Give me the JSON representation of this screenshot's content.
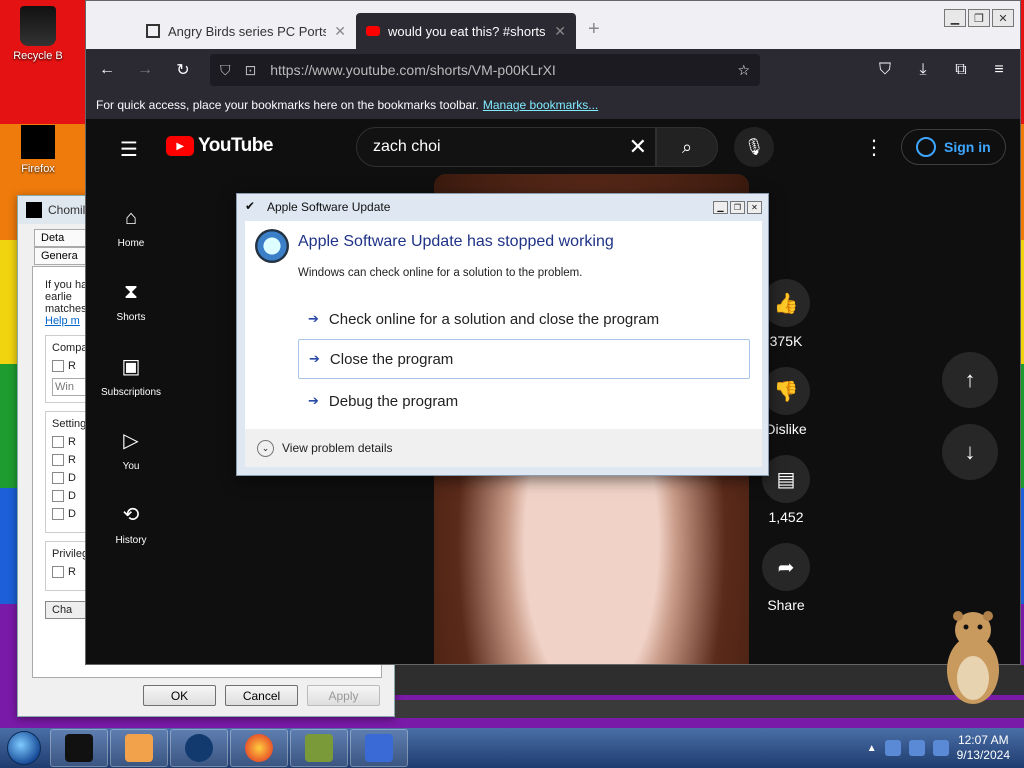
{
  "desktop": {
    "icons": [
      {
        "label": "Recycle B"
      },
      {
        "label": "Firefox"
      }
    ]
  },
  "properties_dialog": {
    "title": "Chomil",
    "tabs": [
      "Deta",
      "Genera"
    ],
    "body_text": "If you ha an earlie matches",
    "help_link": "Help m",
    "group_compat": "Compa",
    "compat_select": "Win",
    "group_settings": "Setting",
    "group_privilege": "Privileg",
    "change_button": "Cha",
    "ok": "OK",
    "cancel": "Cancel",
    "apply": "Apply"
  },
  "browser": {
    "tabs": [
      {
        "title": "Angry Birds series PC Ports : Ro",
        "active": false
      },
      {
        "title": "would you eat this? #shorts - Yo",
        "active": true
      }
    ],
    "url": "https://www.youtube.com/shorts/VM-p00KLrXI",
    "bookmarks_msg": "For quick access, place your bookmarks here on the bookmarks toolbar.",
    "bookmarks_link": "Manage bookmarks..."
  },
  "youtube": {
    "logo": "YouTube",
    "search_value": "zach choi",
    "signin": "Sign in",
    "sidebar": [
      {
        "label": "Home",
        "icon": "home-icon"
      },
      {
        "label": "Shorts",
        "icon": "shorts-icon"
      },
      {
        "label": "Subscriptions",
        "icon": "subscriptions-icon"
      },
      {
        "label": "You",
        "icon": "you-icon"
      },
      {
        "label": "History",
        "icon": "history-icon"
      }
    ],
    "actions": {
      "likes": "375K",
      "dislike": "Dislike",
      "comments": "1,452",
      "share": "Share"
    }
  },
  "error_dialog": {
    "title": "Apple Software Update",
    "heading": "Apple Software Update has stopped working",
    "subtext": "Windows can check online for a solution to the problem.",
    "options": [
      "Check online for a solution and close the program",
      "Close the program",
      "Debug the program"
    ],
    "details": "View problem details"
  },
  "taskbar": {
    "time": "12:07 AM",
    "date": "9/13/2024"
  }
}
